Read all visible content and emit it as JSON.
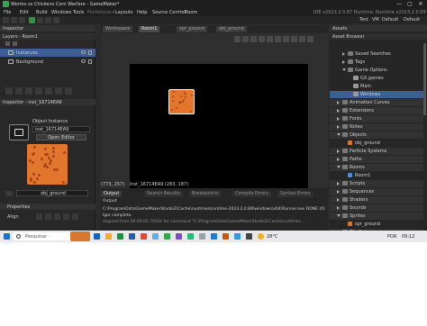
{
  "window": {
    "title": "Worms vs Chickens Corn Warfare - GameMaker*",
    "controls": [
      "—",
      "▢",
      "✕"
    ]
  },
  "menu": {
    "items": [
      "File",
      "Edit",
      "Build",
      "Windows",
      "Tools",
      "Marketplace",
      "Layouts",
      "Help",
      "Source Control",
      "Room"
    ],
    "right_info": "IDE v2023.2.0.87 Runtime: Runtime v2023.2.0.89",
    "target": [
      "Test",
      "VM",
      "Default",
      "Default"
    ]
  },
  "layers_panel": {
    "inspector_label": "Inspector",
    "header": "Layers - Room1",
    "layers": [
      {
        "name": "Instances",
        "selected": true
      },
      {
        "name": "Background",
        "selected": false
      }
    ]
  },
  "instance_inspector": {
    "header": "Inspector - inst_16714EA9",
    "object_instance_label": "Object Instance",
    "instance_name": "inst_16714EA9",
    "open_editor": "Open Editor",
    "object_name": "obj_ground",
    "properties_label": "Properties",
    "align_label": "Align"
  },
  "editor": {
    "tabs": [
      "Workspace",
      "Room1",
      "spr_ground",
      "obj_ground"
    ],
    "active_tab": 1,
    "status_left": "(773, 257)",
    "status_right": "inst_16714EA9 (283, 187)"
  },
  "output": {
    "tabs": [
      "Output",
      "Search Results",
      "Breakpoints",
      "Compile Errors",
      "Syntax Errors"
    ],
    "active_tab": 0,
    "subheader": "Output",
    "lines": [
      "C:\\ProgramData\\GameMakerStudio2\\Cache\\runtimes\\runtime-2023.2.0.89\\windows\\x64\\Runner.exe DONE (0)",
      "Igor complete.",
      "elapsed time 00:00:00.7003s for command \"C:\\ProgramData\\GameMakerStudio2\\Cache\\runtimes..."
    ]
  },
  "assets": {
    "panel_label": "Assets",
    "header": "Asset Browser",
    "items": [
      {
        "label": "Saved Searches",
        "kind": "folder",
        "indent": 2,
        "expanded": false
      },
      {
        "label": "Tags",
        "kind": "folder",
        "indent": 2,
        "expanded": false
      },
      {
        "label": "Game Options",
        "kind": "folder",
        "indent": 2,
        "expanded": true
      },
      {
        "label": "GX.games",
        "kind": "item",
        "indent": 3,
        "expanded": false
      },
      {
        "label": "Main",
        "kind": "item",
        "indent": 3,
        "expanded": false
      },
      {
        "label": "Windows",
        "kind": "item",
        "indent": 3,
        "expanded": false,
        "selected": true
      },
      {
        "label": "Animation Curves",
        "kind": "group",
        "indent": 1,
        "expanded": false
      },
      {
        "label": "Extensions",
        "kind": "group",
        "indent": 1,
        "expanded": false
      },
      {
        "label": "Fonts",
        "kind": "group",
        "indent": 1,
        "expanded": false
      },
      {
        "label": "Notes",
        "kind": "group",
        "indent": 1,
        "expanded": false
      },
      {
        "label": "Objects",
        "kind": "group",
        "indent": 1,
        "expanded": true
      },
      {
        "label": "obj_ground",
        "kind": "asset",
        "indent": 2,
        "expanded": false,
        "color": "#d4762f"
      },
      {
        "label": "Particle Systems",
        "kind": "group",
        "indent": 1,
        "expanded": false
      },
      {
        "label": "Paths",
        "kind": "group",
        "indent": 1,
        "expanded": false
      },
      {
        "label": "Rooms",
        "kind": "group",
        "indent": 1,
        "expanded": true
      },
      {
        "label": "Room1",
        "kind": "asset",
        "indent": 2,
        "expanded": false,
        "color": "#4e8bd1"
      },
      {
        "label": "Scripts",
        "kind": "group",
        "indent": 1,
        "expanded": false
      },
      {
        "label": "Sequences",
        "kind": "group",
        "indent": 1,
        "expanded": false
      },
      {
        "label": "Shaders",
        "kind": "group",
        "indent": 1,
        "expanded": false
      },
      {
        "label": "Sounds",
        "kind": "group",
        "indent": 1,
        "expanded": false
      },
      {
        "label": "Sprites",
        "kind": "group",
        "indent": 1,
        "expanded": true
      },
      {
        "label": "spr_ground",
        "kind": "asset",
        "indent": 2,
        "expanded": false,
        "color": "#d4762f"
      },
      {
        "label": "Tile Sets",
        "kind": "group",
        "indent": 1,
        "expanded": false
      }
    ]
  },
  "taskbar": {
    "search_placeholder": "Pesquisar",
    "temperature": "28°C",
    "language": "POR",
    "time": "09:12",
    "icon_colors": [
      "#0a64c2",
      "#f2b01d",
      "#1f8f3f",
      "#1b5fb8",
      "#e04a2f",
      "#5bb0f0",
      "#2fa84f",
      "#7a4bd1",
      "#1dbf73",
      "#a0a0a0",
      "#1b7fd8",
      "#d35400",
      "#2f9be0",
      "#444444"
    ]
  },
  "colors": {
    "accent": "#3e5f93",
    "sprite_orange": "#e2762d",
    "sprite_dot": "#a8461a"
  }
}
